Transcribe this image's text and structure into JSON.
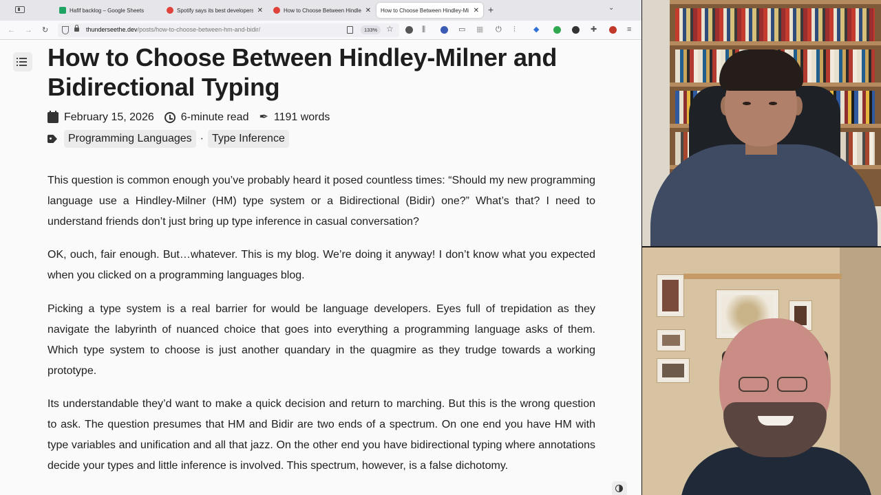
{
  "browser": {
    "tabs": [
      {
        "title": "Hafif backlog – Google Sheets",
        "favicon_color": "#1fa463",
        "active": false
      },
      {
        "title": "Spotify says its best developers",
        "favicon_color": "#e0413a",
        "active": false
      },
      {
        "title": "How to Choose Between Hindle",
        "favicon_color": "#e0413a",
        "active": false
      },
      {
        "title": "How to Choose Between Hindley-Mi",
        "favicon_color": "#ffffff",
        "active": true
      }
    ],
    "new_tab_icon": "+",
    "tab_list_icon": "⌄",
    "url": {
      "host": "thunderseethe.dev",
      "path": "/posts/how-to-choose-between-hm-and-bidir/"
    },
    "zoom": "133%"
  },
  "article": {
    "title": "How to Choose Between Hindley-Milner and Bidirectional Typing",
    "date": "February 15, 2026",
    "read_time": "6-minute read",
    "word_count": "1191 words",
    "tags": [
      "Programming Languages",
      "Type Inference"
    ],
    "tag_separator": "·",
    "paragraphs": [
      "This question is common enough you’ve probably heard it posed countless times: “Should my new pro­gramming language use a Hindley-Milner (HM) type system or a Bidirectional (Bidir) one?” What’s that? I need to understand friends don’t just bring up type inference in casual conversation?",
      "OK, ouch, fair enough. But…whatever. This is my blog. We’re doing it anyway! I don’t know what you ex­pected when you clicked on a programming languages blog.",
      "Picking a type system is a real barrier for would be language developers. Eyes full of trepidation as they navigate the labyrinth of nuanced choice that goes into everything a programming language asks of them. Which type system to choose is just another quandary in the quagmire as they trudge towards a working prototype.",
      "Its understandable they’d want to make a quick decision and return to marching. But this is the wrong question to ask. The question presumes that HM and Bidir are two ends of a spectrum. On one end you have HM with type variables and unification and all that jazz. On the other end you have bidirectional typ­ing where annotations decide your types and little inference is involved. This spectrum, however, is a false dichotomy."
    ]
  },
  "colors": {
    "text": "#1e1e1e",
    "page_bg": "#fafafa",
    "chip_bg": "#ebebeb",
    "tabbar_bg": "#e6e6ea"
  }
}
